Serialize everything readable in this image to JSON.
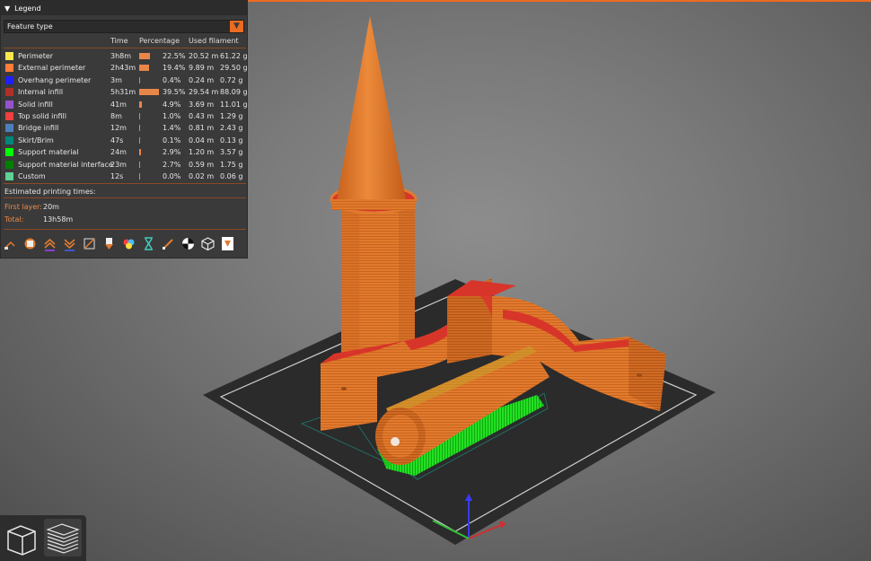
{
  "legend": {
    "title": "Legend",
    "combo_value": "Feature type",
    "columns": {
      "time": "Time",
      "percentage": "Percentage",
      "used_filament": "Used filament"
    },
    "rows": [
      {
        "name": "Perimeter",
        "time": "3h8m",
        "pct": "22.5%",
        "length": "20.52 m",
        "weight": "61.22 g",
        "color": "#ffe64d",
        "bar": 22.5
      },
      {
        "name": "External perimeter",
        "time": "2h43m",
        "pct": "19.4%",
        "length": "9.89 m",
        "weight": "29.50 g",
        "color": "#ff7d38",
        "bar": 19.4
      },
      {
        "name": "Overhang perimeter",
        "time": "3m",
        "pct": "0.4%",
        "length": "0.24 m",
        "weight": "0.72 g",
        "color": "#1f1fff",
        "bar": 0.4
      },
      {
        "name": "Internal infill",
        "time": "5h31m",
        "pct": "39.5%",
        "length": "29.54 m",
        "weight": "88.09 g",
        "color": "#b03029",
        "bar": 39.5
      },
      {
        "name": "Solid infill",
        "time": "41m",
        "pct": "4.9%",
        "length": "3.69 m",
        "weight": "11.01 g",
        "color": "#9654cc",
        "bar": 4.9
      },
      {
        "name": "Top solid infill",
        "time": "8m",
        "pct": "1.0%",
        "length": "0.43 m",
        "weight": "1.29 g",
        "color": "#f04040",
        "bar": 1.0
      },
      {
        "name": "Bridge infill",
        "time": "12m",
        "pct": "1.4%",
        "length": "0.81 m",
        "weight": "2.43 g",
        "color": "#4d80ba",
        "bar": 1.4
      },
      {
        "name": "Skirt/Brim",
        "time": "47s",
        "pct": "0.1%",
        "length": "0.04 m",
        "weight": "0.13 g",
        "color": "#00877a",
        "bar": 0.1
      },
      {
        "name": "Support material",
        "time": "24m",
        "pct": "2.9%",
        "length": "1.20 m",
        "weight": "3.57 g",
        "color": "#00ff00",
        "bar": 2.9
      },
      {
        "name": "Support material interface",
        "time": "23m",
        "pct": "2.7%",
        "length": "0.59 m",
        "weight": "1.75 g",
        "color": "#008000",
        "bar": 2.7
      },
      {
        "name": "Custom",
        "time": "12s",
        "pct": "0.0%",
        "length": "0.02 m",
        "weight": "0.06 g",
        "color": "#5ed194",
        "bar": 0.0
      }
    ],
    "estimated_label": "Estimated printing times:",
    "first_layer_label": "First layer:",
    "first_layer_value": "20m",
    "total_label": "Total:",
    "total_value": "13h58m",
    "tool_icons": [
      "travel-icon",
      "wipe-icon",
      "retractions-icon",
      "deretractions-icon",
      "seams-icon",
      "tool-changes-icon",
      "color-changes-icon",
      "pause-prints-icon",
      "custom-gcodes-icon",
      "center-of-gravity-icon",
      "shells-icon",
      "tool-marker-icon"
    ]
  },
  "colors": {
    "accent": "#ed6b21",
    "panel": "#3a3a3a",
    "model": "#e07b30",
    "support": "#22dd22",
    "top": "#d8352a"
  },
  "view_buttons": [
    "3d-view-icon",
    "sliced-layers-icon"
  ]
}
